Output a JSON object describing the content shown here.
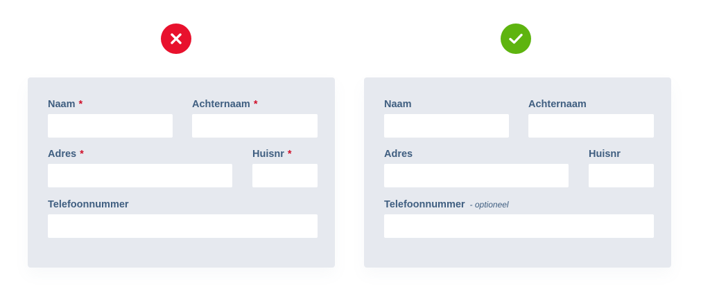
{
  "colors": {
    "panel_bg": "#e6e9ef",
    "label": "#3f5e80",
    "required": "#d0102a",
    "optional": "#3f5e80",
    "input_bg": "#ffffff",
    "bad_badge": "#e8112d",
    "good_badge": "#5eb40f"
  },
  "bad_example": {
    "badge_icon": "cross-icon",
    "fields": {
      "naam": {
        "label": "Naam",
        "marker": "*"
      },
      "achternaam": {
        "label": "Achternaam",
        "marker": "*"
      },
      "adres": {
        "label": "Adres",
        "marker": "*"
      },
      "huisnr": {
        "label": "Huisnr",
        "marker": "*"
      },
      "telefoon": {
        "label": "Telefoonnummer"
      }
    }
  },
  "good_example": {
    "badge_icon": "checkmark-icon",
    "fields": {
      "naam": {
        "label": "Naam"
      },
      "achternaam": {
        "label": "Achternaam"
      },
      "adres": {
        "label": "Adres"
      },
      "huisnr": {
        "label": "Huisnr"
      },
      "telefoon": {
        "label": "Telefoonnummer",
        "optional_note": "- optioneel"
      }
    }
  }
}
